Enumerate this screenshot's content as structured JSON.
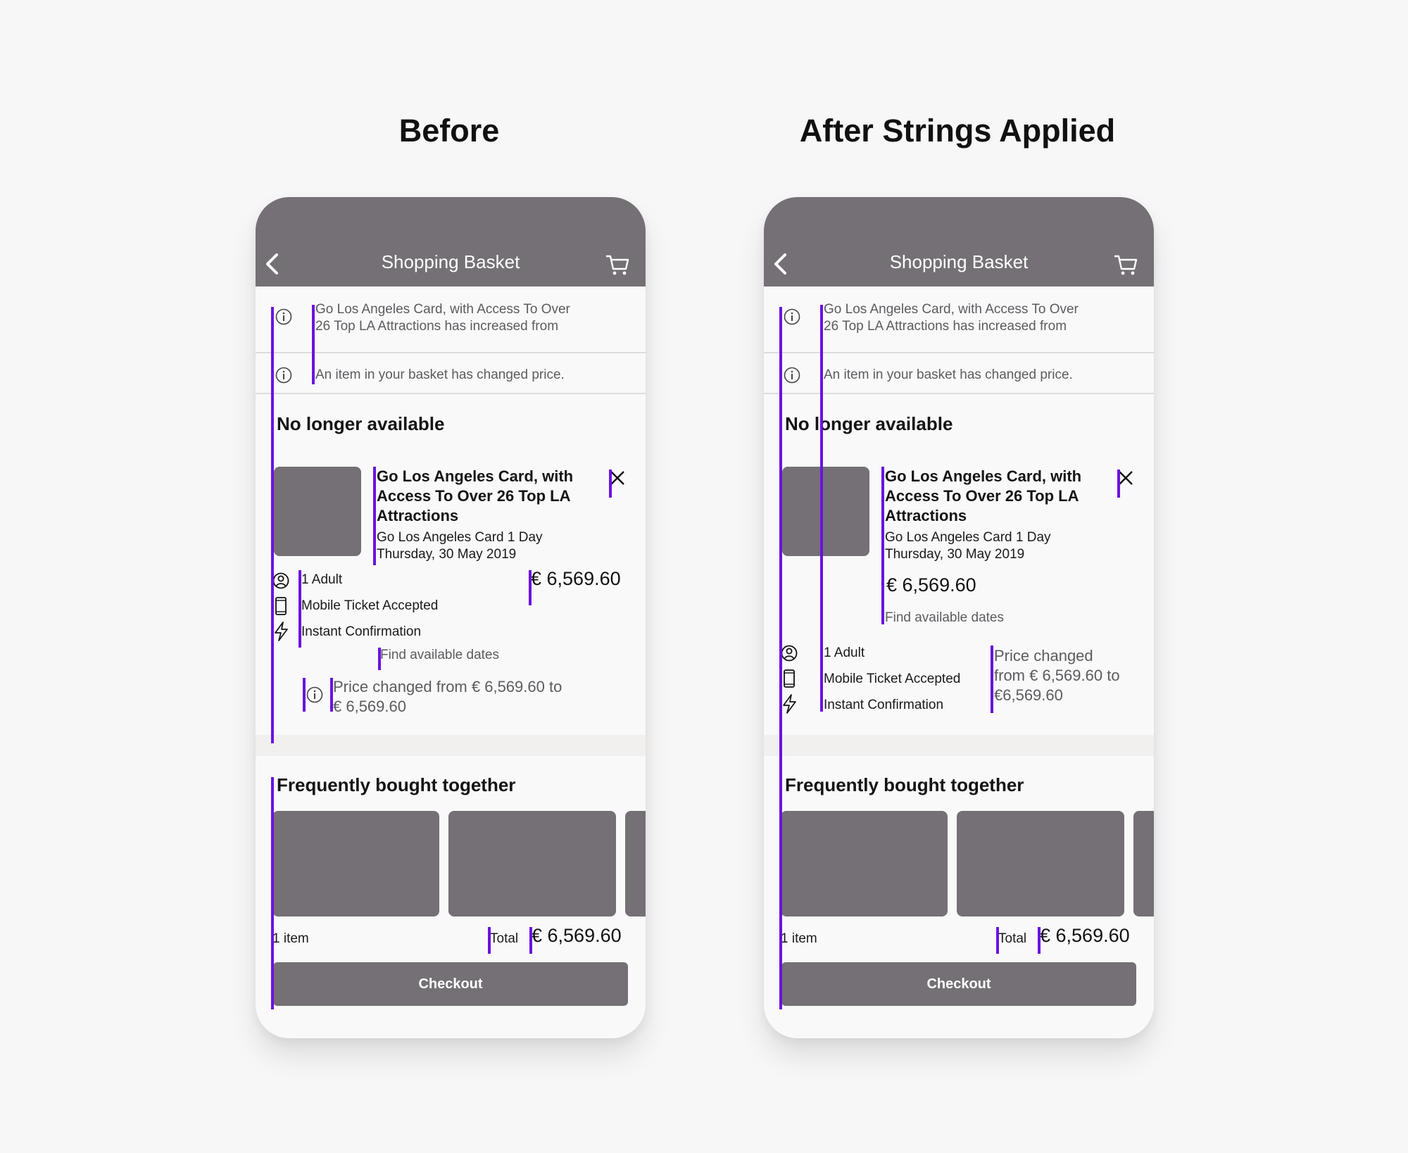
{
  "columns": [
    {
      "id": "before",
      "heading": "Before"
    },
    {
      "id": "after",
      "heading": "After Strings Applied"
    }
  ],
  "screen": {
    "header_title": "Shopping Basket",
    "notice_1": [
      "Go Los Angeles Card, with Access To Over",
      "26 Top LA Attractions has increased from"
    ],
    "notice_2": "An item in your basket has changed price.",
    "unavailable_heading": "No longer available",
    "product_title_lines": [
      "Go Los Angeles Card, with",
      "Access To Over 26 Top LA",
      "Attractions"
    ],
    "product_variant": "Go Los Angeles Card 1 Day",
    "product_date": "Thursday, 30 May 2019",
    "price": "€ 6,569.60",
    "features": [
      "1 Adult",
      "Mobile Ticket Accepted",
      "Instant Confirmation"
    ],
    "find_dates": "Find available dates",
    "price_changed_before": [
      "Price changed from € 6,569.60 to",
      "€ 6,569.60"
    ],
    "price_changed_after": [
      "Price changed",
      "from € 6,569.60 to",
      "€6,569.60"
    ],
    "fbt_heading": "Frequently bought together",
    "item_count": "1 item",
    "total_label": "Total",
    "total_price": "€ 6,569.60",
    "checkout_label": "Checkout"
  },
  "colors": {
    "header_bg": "#747075",
    "placeholder": "#747075",
    "guide_lines": "#6b12e0",
    "page_bg": "#f7f7f8"
  },
  "icons": [
    "back-arrow-icon",
    "cart-icon",
    "info-icon",
    "close-icon",
    "user-icon",
    "mobile-icon",
    "lightning-icon"
  ]
}
